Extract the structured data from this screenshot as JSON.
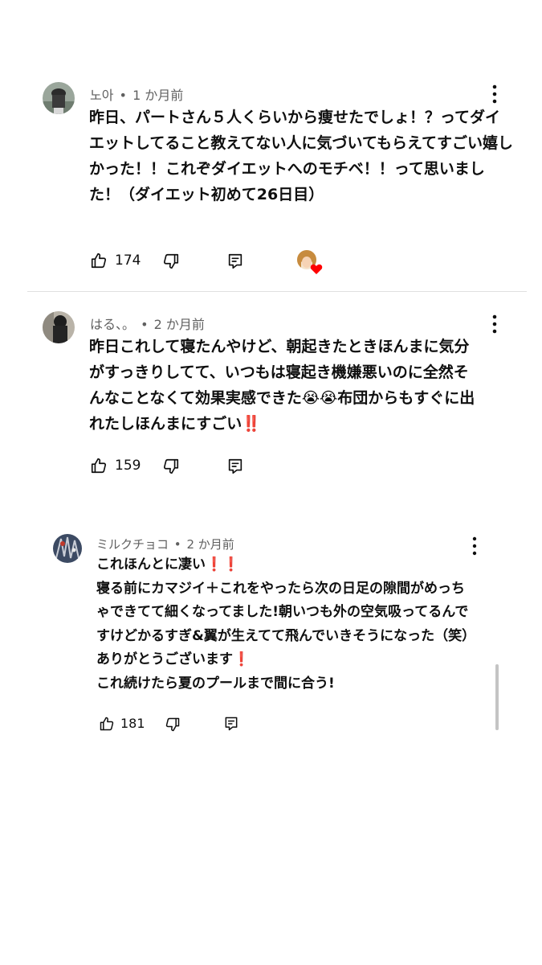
{
  "comments": [
    {
      "author": "노아",
      "time": "1 か月前",
      "separator": "•",
      "text": "昨日、パートさん５人くらいから痩せたでしょ！？ってダイエットしてること教えてない人に気づいてもらえてすごい嬉しかった！！これぞダイエットへのモチベ！！って思いました！（ダイエット初めて26日目）",
      "likes": "174",
      "creator_heart": true
    },
    {
      "author": "はる、。",
      "time": "2 か月前",
      "separator": "•",
      "text": "昨日これして寝たんやけど、朝起きたときほんまに気分がすっきりしてて、いつもは寝起き機嫌悪いのに全然そんなことなくて効果実感できた😭😭布団からもすぐに出れたしほんまにすごい‼️",
      "likes": "159",
      "creator_heart": false
    },
    {
      "author": "ミルクチョコ",
      "time": "2 か月前",
      "separator": "•",
      "text": "これほんとに凄い❗️❗️\n寝る前にカマジイ＋これをやったら次の日足の隙間がめっちゃできてて細くなってました!朝いつも外の空気吸ってるんですけどかるすぎ&翼が生えてて飛んでいきそうになった（笑）ありがとうございます❗️\nこれ続けたら夏のプールまで間に合う!",
      "likes": "181",
      "creator_heart": false
    }
  ],
  "icons": {
    "like": "thumbs-up-icon",
    "dislike": "thumbs-down-icon",
    "reply": "reply-icon",
    "more": "more-vert-icon",
    "heart": "creator-heart-icon"
  },
  "colors": {
    "text": "#0f0f0f",
    "meta": "#606060",
    "heart": "#ff0000"
  }
}
